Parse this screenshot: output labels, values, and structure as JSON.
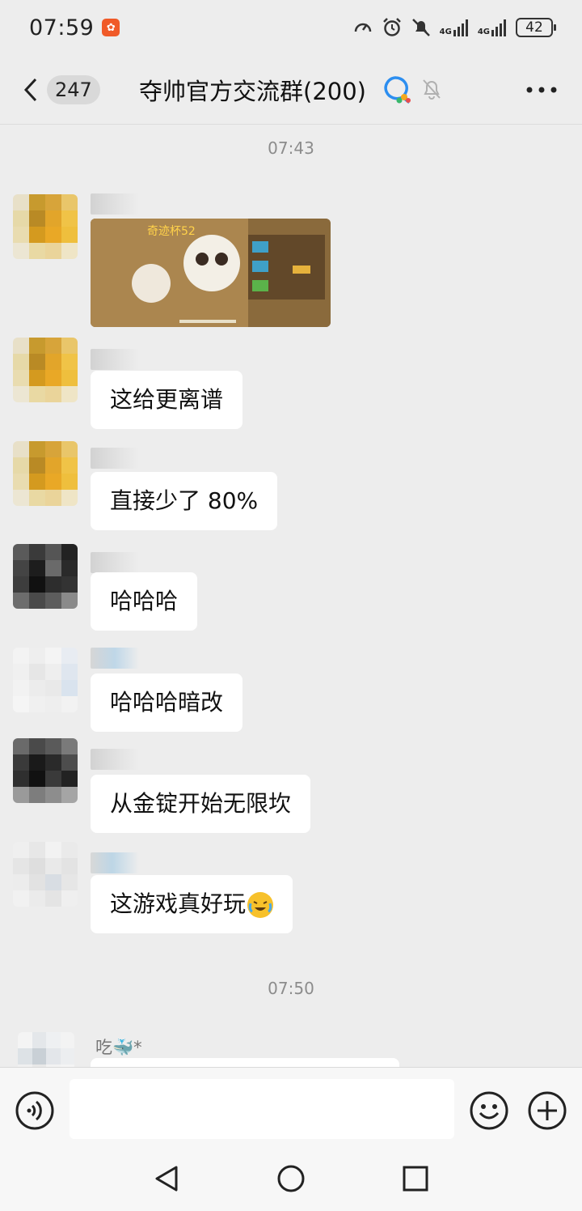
{
  "status_bar": {
    "time": "07:59",
    "network_1": "4G",
    "network_2": "4G",
    "battery": "42"
  },
  "header": {
    "unread_count": "247",
    "title": "夺帅官方交流群(200)"
  },
  "chat": {
    "timestamps": [
      "07:43",
      "07:50"
    ],
    "messages": [
      {
        "type": "image",
        "content": ""
      },
      {
        "type": "text",
        "text": "这给更离谱"
      },
      {
        "type": "text",
        "text": "直接少了 80%"
      },
      {
        "type": "text",
        "text": "哈哈哈"
      },
      {
        "type": "text",
        "text": "哈哈哈暗改"
      },
      {
        "type": "text",
        "text": "从金锭开始无限坎"
      },
      {
        "type": "text",
        "text": "这游戏真好玩"
      }
    ],
    "last_sender": "吃🐳*"
  },
  "colors": {
    "background": "#ededed",
    "bubble": "#ffffff",
    "input_bar": "#f7f7f7"
  }
}
